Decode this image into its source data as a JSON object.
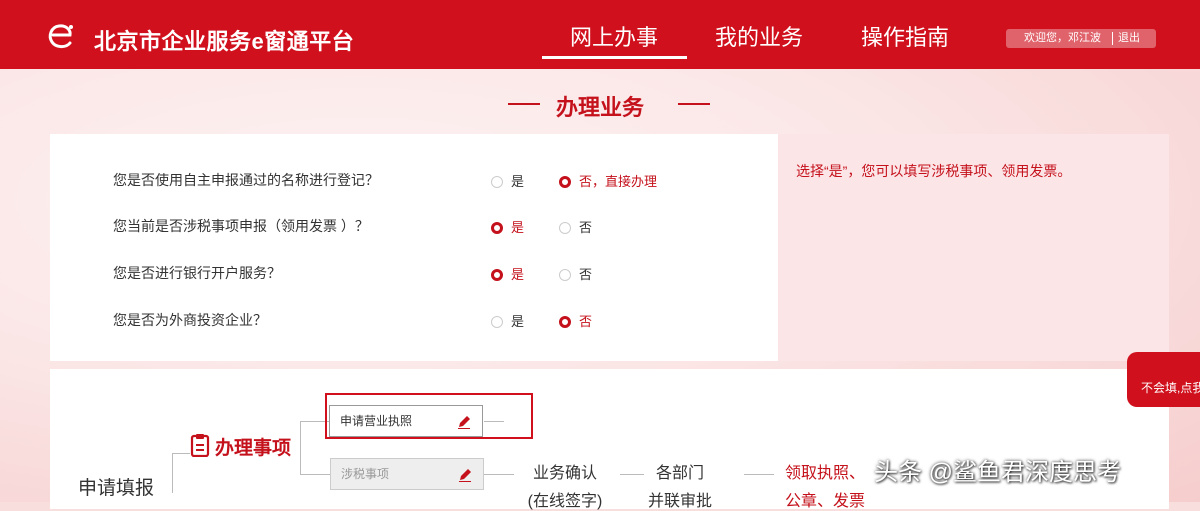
{
  "header": {
    "logo_text": "北京市企业服务e窗通平台",
    "nav": [
      {
        "label": "网上办事",
        "active": true
      },
      {
        "label": "我的业务",
        "active": false
      },
      {
        "label": "操作指南",
        "active": false
      }
    ],
    "user": {
      "greeting": "欢迎您，邓江波",
      "logout": "退出"
    }
  },
  "section_title": "办理业务",
  "questions": [
    {
      "label": "您是否使用自主申报通过的名称进行登记？",
      "options": [
        {
          "label": "是",
          "selected": false
        },
        {
          "label": "否，直接办理",
          "selected": true
        }
      ]
    },
    {
      "label": "您当前是否涉税事项申报（领用发票 ）？",
      "options": [
        {
          "label": "是",
          "selected": true
        },
        {
          "label": "否",
          "selected": false
        }
      ]
    },
    {
      "label": "您是否进行银行开户服务？",
      "options": [
        {
          "label": "是",
          "selected": true
        },
        {
          "label": "否",
          "selected": false
        }
      ]
    },
    {
      "label": "您是否为外商投资企业？",
      "options": [
        {
          "label": "是",
          "selected": false
        },
        {
          "label": "否",
          "selected": true
        }
      ]
    }
  ],
  "tip": "选择“是”，您可以填写涉税事项、领用发票。",
  "flow": {
    "start": "申请填报",
    "handle_title": "办理事项",
    "items": [
      {
        "label": "申请营业执照",
        "active": true
      },
      {
        "label": "涉税事项",
        "active": false
      }
    ],
    "step1": {
      "line1": "业务确认",
      "line2": "(在线签字)"
    },
    "step2": {
      "line1": "各部门",
      "line2": "并联审批"
    },
    "step3": {
      "line1": "领取执照、",
      "line2": "公章、发票"
    }
  },
  "side_float": "不会填,点我",
  "watermark": "头条 @鲨鱼君深度思考",
  "colors": {
    "brand": "#d0101c",
    "accent_text": "#c4111b"
  }
}
